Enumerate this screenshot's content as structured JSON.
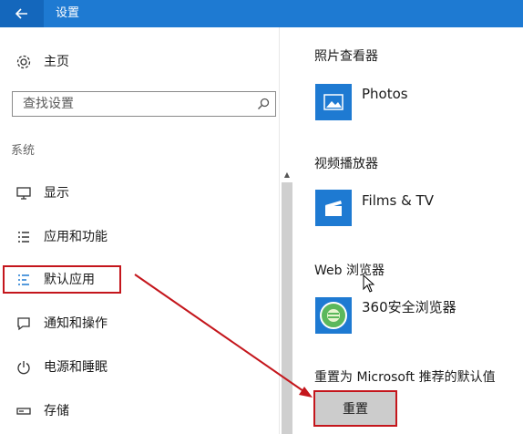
{
  "window": {
    "title": "设置",
    "back_icon": "back-arrow-icon"
  },
  "sidebar": {
    "home_label": "主页",
    "search_placeholder": "查找设置",
    "section_label": "系统",
    "items": [
      {
        "label": "显示",
        "icon": "display-icon"
      },
      {
        "label": "应用和功能",
        "icon": "apps-list-icon"
      },
      {
        "label": "默认应用",
        "icon": "default-apps-icon",
        "selected": true
      },
      {
        "label": "通知和操作",
        "icon": "notification-icon"
      },
      {
        "label": "电源和睡眠",
        "icon": "power-icon"
      },
      {
        "label": "存储",
        "icon": "storage-icon"
      }
    ]
  },
  "main": {
    "photo_viewer": {
      "heading": "照片查看器",
      "app": "Photos"
    },
    "video_player": {
      "heading": "视频播放器",
      "app": "Films & TV"
    },
    "web_browser": {
      "heading": "Web 浏览器",
      "app": "360安全浏览器"
    },
    "reset": {
      "heading": "重置为 Microsoft 推荐的默认值",
      "button": "重置"
    }
  },
  "colors": {
    "accent": "#1e7ad2",
    "annotation": "#c4161c",
    "browser_green": "#5cb85c"
  }
}
